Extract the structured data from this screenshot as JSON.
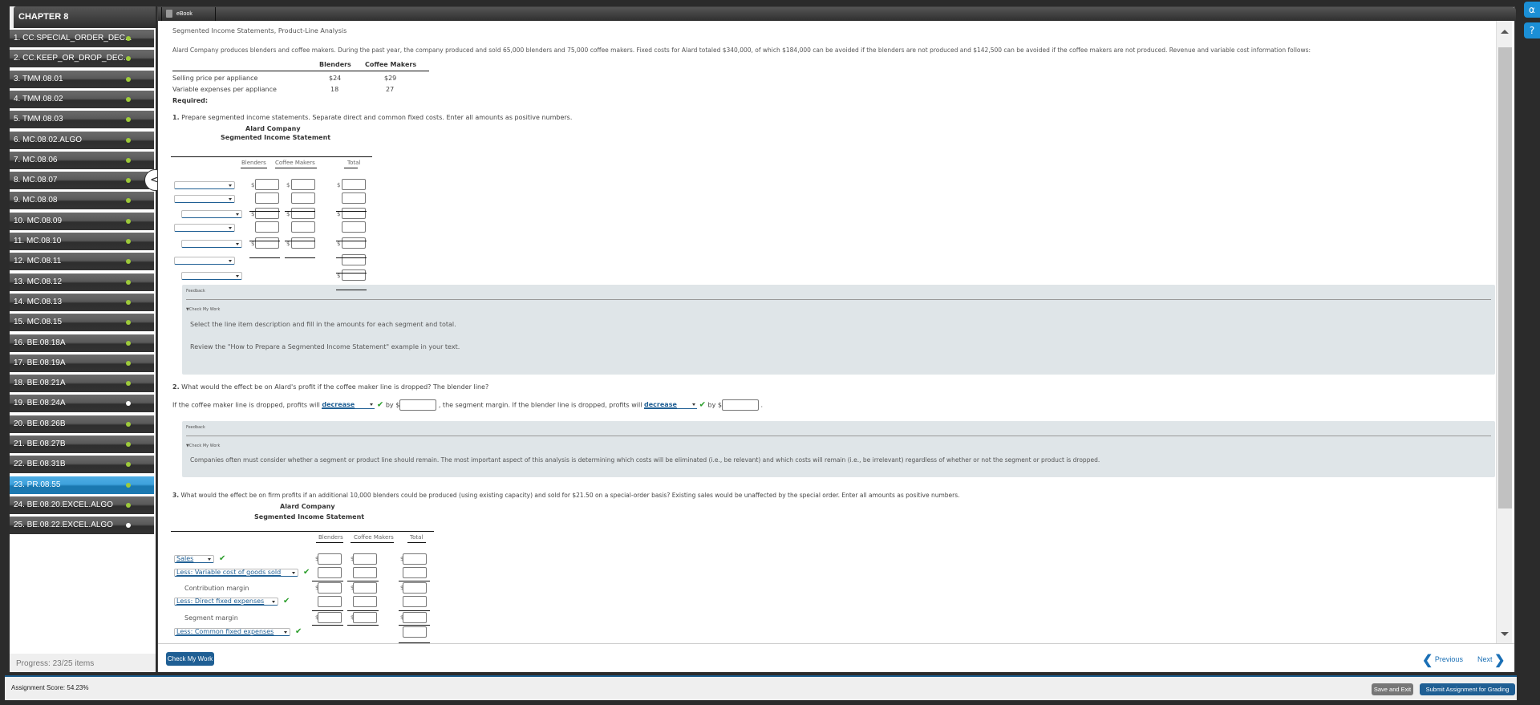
{
  "sidebar": {
    "chapter": "CHAPTER 8",
    "items": [
      {
        "label": "1. CC.SPECIAL_ORDER_DEC...",
        "status": "complete"
      },
      {
        "label": "2. CC.KEEP_OR_DROP_DEC...",
        "status": "complete"
      },
      {
        "label": "3. TMM.08.01",
        "status": "complete"
      },
      {
        "label": "4. TMM.08.02",
        "status": "complete"
      },
      {
        "label": "5. TMM.08.03",
        "status": "complete"
      },
      {
        "label": "6. MC.08.02.ALGO",
        "status": "complete"
      },
      {
        "label": "7. MC.08.06",
        "status": "complete"
      },
      {
        "label": "8. MC.08.07",
        "status": "complete"
      },
      {
        "label": "9. MC.08.08",
        "status": "complete"
      },
      {
        "label": "10. MC.08.09",
        "status": "complete"
      },
      {
        "label": "11. MC.08.10",
        "status": "complete"
      },
      {
        "label": "12. MC.08.11",
        "status": "complete"
      },
      {
        "label": "13. MC.08.12",
        "status": "complete"
      },
      {
        "label": "14. MC.08.13",
        "status": "complete"
      },
      {
        "label": "15. MC.08.15",
        "status": "complete"
      },
      {
        "label": "16. BE.08.18A",
        "status": "complete"
      },
      {
        "label": "17. BE.08.19A",
        "status": "complete"
      },
      {
        "label": "18. BE.08.21A",
        "status": "complete"
      },
      {
        "label": "19. BE.08.24A",
        "status": "incomplete"
      },
      {
        "label": "20. BE.08.26B",
        "status": "complete"
      },
      {
        "label": "21. BE.08.27B",
        "status": "complete"
      },
      {
        "label": "22. BE.08.31B",
        "status": "complete"
      },
      {
        "label": "23. PR.08.55",
        "status": "complete",
        "active": true
      },
      {
        "label": "24. BE.08.20.EXCEL.ALGO",
        "status": "complete"
      },
      {
        "label": "25. BE.08.22.EXCEL.ALGO",
        "status": "incomplete"
      }
    ],
    "progress": "Progress:  23/25 items"
  },
  "tabs": {
    "ebook": "eBook"
  },
  "problem": {
    "title": "Segmented Income Statements, Product-Line Analysis",
    "intro": "Alard Company produces blenders and coffee makers. During the past year, the company produced and sold 65,000 blenders and 75,000 coffee makers. Fixed costs for Alard totaled $340,000, of which $184,000 can be avoided if the blenders are not produced and $142,500 can be avoided if the coffee makers are not produced. Revenue and variable cost information follows:",
    "info_table": {
      "headers": [
        "Blenders",
        "Coffee Makers"
      ],
      "rows": [
        {
          "label": "Selling price per appliance",
          "blenders": "$24",
          "coffee": "$29"
        },
        {
          "label": "Variable expenses per appliance",
          "blenders": "18",
          "coffee": "27"
        }
      ]
    },
    "required": "Required:"
  },
  "q1": {
    "num": "1.",
    "text": "Prepare segmented income statements. Separate direct and common fixed costs. Enter all amounts as positive numbers.",
    "company": "Alard Company",
    "statement": "Segmented Income Statement",
    "col_headers": [
      "Blenders",
      "Coffee Makers",
      "Total"
    ],
    "dollar": "$",
    "feedback": {
      "title": "Feedback",
      "toggle": "Check My Work",
      "lines": [
        "Select the line item description and fill in the amounts for each segment and total.",
        "Review the \"How to Prepare a Segmented Income Statement\" example in your text."
      ]
    }
  },
  "q2": {
    "num": "2.",
    "text": "What would the effect be on Alard's profit if the coffee maker line is dropped? The blender line?",
    "sentence_a": "If the coffee maker line is dropped, profits will",
    "select_a": "decrease",
    "by": "by $",
    "sentence_b": ", the segment margin. If the blender line is dropped, profits will",
    "select_b": "decrease",
    "end": ".",
    "feedback": {
      "title": "Feedback",
      "toggle": "Check My Work",
      "lines": [
        "Companies often must consider whether a segment or product line should remain. The most important aspect of this analysis is determining which costs will be eliminated (i.e., be relevant) and which costs will remain (i.e., be irrelevant) regardless of whether or not the segment or product is dropped."
      ]
    }
  },
  "q3": {
    "num": "3.",
    "text": "What would the effect be on firm profits if an additional 10,000 blenders could be produced (using existing capacity) and sold for $21.50 on a special-order basis? Existing sales would be unaffected by the special order. Enter all amounts as positive numbers.",
    "company": "Alard Company",
    "statement": "Segmented Income Statement",
    "col_headers": [
      "Blenders",
      "Coffee Makers",
      "Total"
    ],
    "rows": {
      "sales": "Sales",
      "variable": "Less: Variable cost of goods sold",
      "contribution": "Contribution margin",
      "direct": "Less: Direct fixed expenses",
      "segment": "Segment margin",
      "common": "Less: Common fixed expenses"
    }
  },
  "footer": {
    "check_my_work": "Check My Work",
    "previous": "Previous",
    "next": "Next",
    "score": "Assignment Score:   54.23%",
    "save_exit": "Save and Exit",
    "submit": "Submit Assignment for Grading"
  },
  "icons": {
    "support": "headset-icon",
    "help": "help-icon",
    "collapse": "chevron-left-icon"
  }
}
